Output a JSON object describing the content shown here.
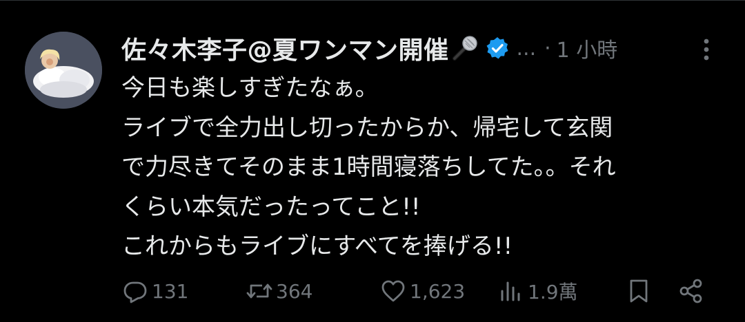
{
  "tweet": {
    "display_name": "佐々木李子@夏ワンマン開催",
    "handle_truncated": "...",
    "separator": "·",
    "timestamp": "1 小時",
    "body_lines": [
      "今日も楽しすぎたなぁ。",
      "ライブで全力出し切ったからか、帰宅して玄関",
      "で力尽きてそのまま1時間寝落ちしてた。。それ",
      "くらい本気だったってこと!!",
      "これからもライブにすべてを捧げる!!"
    ],
    "icons": {
      "name_emoji": "microphone-icon",
      "verified": "verified-badge-icon",
      "more": "more-options-icon"
    }
  },
  "actions": {
    "reply": {
      "icon": "reply-icon",
      "count": "131"
    },
    "retweet": {
      "icon": "retweet-icon",
      "count": "364"
    },
    "like": {
      "icon": "like-icon",
      "count": "1,623"
    },
    "views": {
      "icon": "views-icon",
      "count": "1.9萬"
    },
    "bookmark": {
      "icon": "bookmark-icon"
    },
    "share": {
      "icon": "share-icon"
    }
  },
  "colors": {
    "background": "#000000",
    "text_primary": "#e7e9ea",
    "text_secondary": "#71767b",
    "verified_blue": "#1d9bf0",
    "divider": "#2f3336"
  }
}
